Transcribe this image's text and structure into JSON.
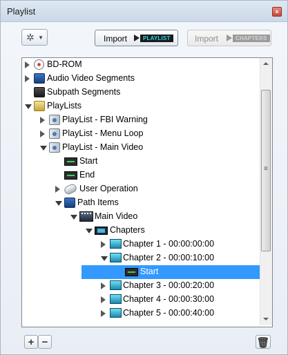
{
  "window": {
    "title": "Playlist"
  },
  "toolbar": {
    "import_playlist": {
      "label": "Import",
      "tag": "PLAYLIST"
    },
    "import_chapters": {
      "label": "Import",
      "tag": "CHAPTERS"
    }
  },
  "tree": [
    {
      "label": "BD-ROM",
      "level": 0,
      "expander": "closed",
      "icon": "disc-icon",
      "icon_class": "disc"
    },
    {
      "label": "Audio Video Segments",
      "level": 0,
      "expander": "closed",
      "icon": "folder-icon",
      "icon_class": "folder-blue"
    },
    {
      "label": "Subpath Segments",
      "level": 0,
      "expander": "none",
      "icon": "folder-icon",
      "icon_class": "folder-dark"
    },
    {
      "label": "PlayLists",
      "level": 0,
      "expander": "open",
      "icon": "folder-icon",
      "icon_class": "folder-yellow"
    },
    {
      "label": "PlayList - FBI Warning",
      "level": 1,
      "expander": "closed",
      "icon": "playlist-icon",
      "icon_class": "playlist"
    },
    {
      "label": "PlayList - Menu Loop",
      "level": 1,
      "expander": "closed",
      "icon": "playlist-icon",
      "icon_class": "playlist"
    },
    {
      "label": "PlayList - Main Video",
      "level": 1,
      "expander": "open",
      "icon": "playlist-icon",
      "icon_class": "playlist"
    },
    {
      "label": "Start",
      "level": 2,
      "expander": "none",
      "icon": "mark-icon",
      "icon_class": "mark"
    },
    {
      "label": "End",
      "level": 2,
      "expander": "none",
      "icon": "mark-icon",
      "icon_class": "mark"
    },
    {
      "label": "User Operation",
      "level": 2,
      "expander": "closed",
      "icon": "user-operation-icon",
      "icon_class": "userop"
    },
    {
      "label": "Path Items",
      "level": 2,
      "expander": "open",
      "icon": "folder-icon",
      "icon_class": "folder-blue"
    },
    {
      "label": "Main Video",
      "level": 3,
      "expander": "open",
      "icon": "movie-icon",
      "icon_class": "movie"
    },
    {
      "label": "Chapters",
      "level": 4,
      "expander": "open",
      "icon": "chapters-icon",
      "icon_class": "chapters"
    },
    {
      "label": "Chapter 1 - 00:00:00:00",
      "level": 5,
      "expander": "closed",
      "icon": "chapter-icon",
      "icon_class": "frame"
    },
    {
      "label": "Chapter 2 - 00:00:10:00",
      "level": 5,
      "expander": "open",
      "icon": "chapter-icon",
      "icon_class": "frame"
    },
    {
      "label": "Start",
      "level": 6,
      "expander": "none",
      "icon": "mark-icon",
      "icon_class": "mark",
      "selected": true
    },
    {
      "label": "Chapter 3 - 00:00:20:00",
      "level": 5,
      "expander": "closed",
      "icon": "chapter-icon",
      "icon_class": "frame"
    },
    {
      "label": "Chapter 4 - 00:00:30:00",
      "level": 5,
      "expander": "closed",
      "icon": "chapter-icon",
      "icon_class": "frame"
    },
    {
      "label": "Chapter 5 - 00:00:40:00",
      "level": 5,
      "expander": "closed",
      "icon": "chapter-icon",
      "icon_class": "frame"
    }
  ]
}
